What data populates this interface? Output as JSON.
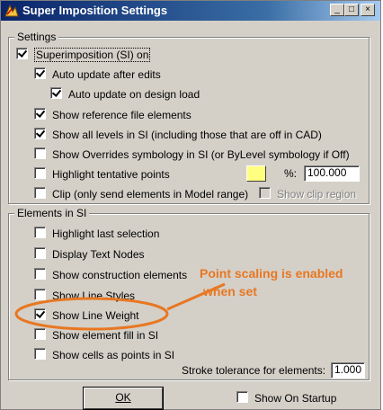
{
  "window": {
    "title": "Super Imposition Settings",
    "minimize_glyph": "_",
    "maximize_glyph": "□",
    "close_glyph": "×"
  },
  "settings_group": {
    "title": "Settings",
    "items": [
      {
        "label": "Superimposition (SI) on",
        "checked": true
      },
      {
        "label": "Auto update after edits",
        "checked": true
      },
      {
        "label": "Auto update on design load",
        "checked": true
      },
      {
        "label": "Show reference file elements",
        "checked": true
      },
      {
        "label": "Show all levels in SI (including those that are off in CAD)",
        "checked": true
      },
      {
        "label": "Show Overrides symbology in SI (or ByLevel symbology if Off)",
        "checked": false
      },
      {
        "label": "Highlight tentative points",
        "checked": false
      },
      {
        "label": "Clip (only send elements in Model range)",
        "checked": false
      },
      {
        "label": "Show clip region",
        "checked": false,
        "disabled": true
      }
    ],
    "highlight_color": "#ffff80",
    "percent_label": "%:",
    "percent_value": "100.000"
  },
  "elements_group": {
    "title": "Elements in SI",
    "items": [
      {
        "label": "Highlight last selection",
        "checked": false
      },
      {
        "label": "Display Text Nodes",
        "checked": false
      },
      {
        "label": "Show construction elements",
        "checked": false
      },
      {
        "label": "Show Line Styles",
        "checked": false
      },
      {
        "label": "Show Line Weight",
        "checked": true
      },
      {
        "label": "Show element fill in SI",
        "checked": false
      },
      {
        "label": "Show cells as points in SI",
        "checked": false
      }
    ],
    "stroke_label": "Stroke tolerance for elements:",
    "stroke_value": "1.000"
  },
  "footer": {
    "ok_label": "OK",
    "startup_label": "Show On Startup",
    "startup_checked": false
  },
  "annotation": {
    "line1": "Point scaling is enabled",
    "line2": "when set",
    "color": "#e87722"
  }
}
